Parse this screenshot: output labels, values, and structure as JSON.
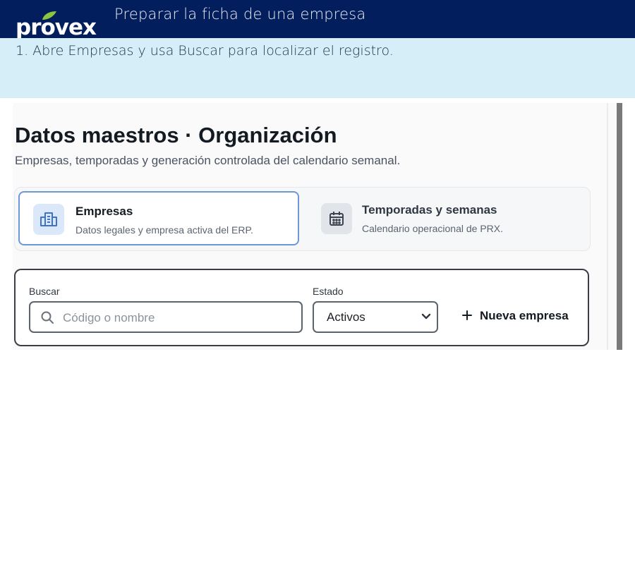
{
  "header": {
    "logo_text": "provex",
    "title": "Preparar la ficha de una empresa",
    "background_color": "#031e5c",
    "leaf_color": "#8cc63f"
  },
  "step": {
    "text": "1. Abre Empresas y usa Buscar para localizar el registro.",
    "background_color": "#d5eef7"
  },
  "screenshot": {
    "title": "Datos maestros · Organización",
    "subtitle": "Empresas, temporadas y generación controlada del calendario semanal.",
    "tabs": [
      {
        "title": "Empresas",
        "description": "Datos legales y empresa activa del ERP.",
        "icon": "building-icon",
        "selected": true
      },
      {
        "title": "Temporadas y semanas",
        "description": "Calendario operacional de PRX.",
        "icon": "calendar-icon",
        "selected": false
      }
    ],
    "filters": {
      "search_label": "Buscar",
      "search_placeholder": "Código o nombre",
      "search_value": "",
      "state_label": "Estado",
      "state_value": "Activos",
      "new_button_label": "Nueva empresa"
    },
    "accent_color": "#6f96d8"
  }
}
